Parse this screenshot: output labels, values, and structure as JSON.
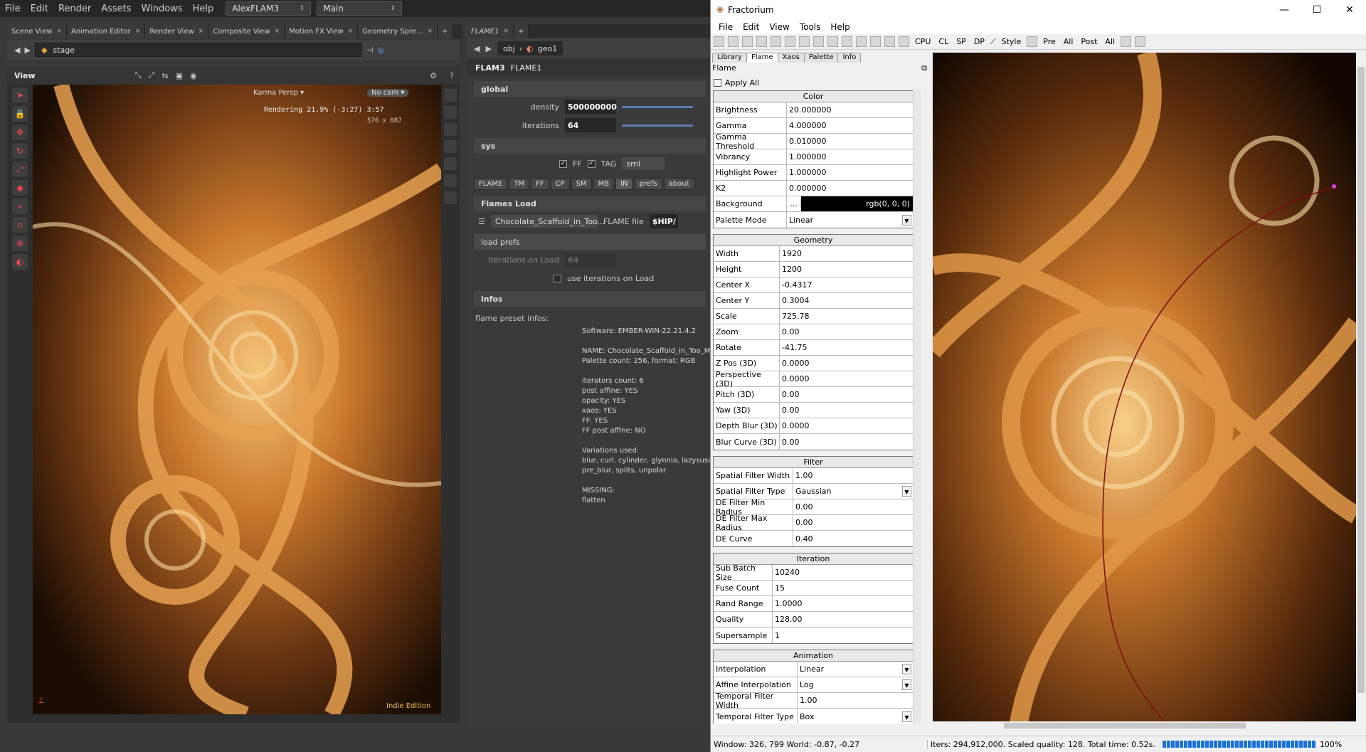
{
  "houdini": {
    "menu": [
      "File",
      "Edit",
      "Render",
      "Assets",
      "Windows",
      "Help"
    ],
    "desktop": "AlexFLAM3",
    "workspace": "Main",
    "viewer_tabs": [
      "Scene View",
      "Animation Editor",
      "Render View",
      "Composite View",
      "Motion FX View",
      "Geometry Spre..."
    ],
    "path": "stage",
    "view_label": "View",
    "renderer": "Karma Persp",
    "camera": "No cam",
    "render_status": "Rendering  21.9%  (-3:27)  3:57",
    "render_res": "576 x 887",
    "edition": "Indie Edition"
  },
  "params": {
    "tab": "FLAME1",
    "crumb_obj": "obj",
    "crumb_geo": "geo1",
    "node_type": "FLAM3",
    "node_name": "FLAME1",
    "global_label": "global",
    "density_label": "density",
    "density": "500000000",
    "iterations_label": "iterations",
    "iterations": "64",
    "sys_label": "sys",
    "ff_label": "FF",
    "tag_label": "TAG",
    "tag_value": "sml",
    "folder_tabs": [
      "FLAME",
      "TM",
      "FF",
      "CP",
      "SM",
      "MB",
      "IN",
      "prefs",
      "about"
    ],
    "flames_load": "Flames Load",
    "preset_name": "Chocolate_Scaffold_in_Too...",
    "flame_file_label": "FLAME file",
    "flame_file_value": "$HIP/",
    "load_prefs": "load prefs",
    "iter_on_load_label": "Iterations on Load",
    "iter_on_load": "64",
    "use_iter_label": "use iterations on Load",
    "infos_label": "infos",
    "preset_infos": "flame preset infos:",
    "info_text": "Software: EMBER-WIN-22.21.4.2\n\nNAME: Chocolate_Scaffold_in_Too_Ma\nPalette count: 256, format: RGB\n\niterators count: 6\npost affine: YES\nopacity: YES\nxaos: YES\nFF: YES\nFF post affine: NO\n\nVariations used:\nblur, curl, cylinder, glynnia, lazysusan\npre_blur, splits, unpolar\n\nMISSING:\nflatten"
  },
  "fractorium": {
    "title": "Fractorium",
    "menu": [
      "File",
      "Edit",
      "View",
      "Tools",
      "Help"
    ],
    "toolbar_text": [
      "CPU",
      "CL",
      "SP",
      "DP",
      "Style",
      "Pre",
      "All",
      "Post",
      "All"
    ],
    "tabs": [
      "Library",
      "Flame",
      "Xaos",
      "Palette",
      "Info"
    ],
    "panel_title": "Flame",
    "apply_all": "Apply All",
    "color": {
      "header": "Color",
      "rows": [
        {
          "label": "Brightness",
          "value": "20.000000"
        },
        {
          "label": "Gamma",
          "value": "4.000000"
        },
        {
          "label": "Gamma Threshold",
          "value": "0.010000"
        },
        {
          "label": "Vibrancy",
          "value": "1.000000"
        },
        {
          "label": "Highlight Power",
          "value": "1.000000"
        },
        {
          "label": "K2",
          "value": "0.000000"
        }
      ],
      "background_label": "Background",
      "background_btn": "...",
      "background_value": "rgb(0, 0, 0)",
      "palette_mode_label": "Palette Mode",
      "palette_mode": "Linear"
    },
    "geometry": {
      "header": "Geometry",
      "rows": [
        {
          "label": "Width",
          "value": "1920"
        },
        {
          "label": "Height",
          "value": "1200"
        },
        {
          "label": "Center X",
          "value": "-0.4317"
        },
        {
          "label": "Center Y",
          "value": "0.3004"
        },
        {
          "label": "Scale",
          "value": "725.78"
        },
        {
          "label": "Zoom",
          "value": "0.00"
        },
        {
          "label": "Rotate",
          "value": "-41.75"
        },
        {
          "label": "Z Pos (3D)",
          "value": "0.0000"
        },
        {
          "label": "Perspective (3D)",
          "value": "0.0000"
        },
        {
          "label": "Pitch (3D)",
          "value": "0.00"
        },
        {
          "label": "Yaw (3D)",
          "value": "0.00"
        },
        {
          "label": "Depth Blur (3D)",
          "value": "0.0000"
        },
        {
          "label": "Blur Curve (3D)",
          "value": "0.00"
        }
      ]
    },
    "filter": {
      "header": "Filter",
      "width_label": "Spatial Filter Width",
      "width": "1.00",
      "type_label": "Spatial Filter Type",
      "type": "Gaussian",
      "rows": [
        {
          "label": "DE Filter Min Radius",
          "value": "0.00"
        },
        {
          "label": "DE Filter Max Radius",
          "value": "0.00"
        },
        {
          "label": "DE Curve",
          "value": "0.40"
        }
      ]
    },
    "iteration": {
      "header": "Iteration",
      "rows": [
        {
          "label": "Sub Batch Size",
          "value": "10240"
        },
        {
          "label": "Fuse Count",
          "value": "15"
        },
        {
          "label": "Rand Range",
          "value": "1.0000"
        },
        {
          "label": "Quality",
          "value": "128.00"
        },
        {
          "label": "Supersample",
          "value": "1"
        }
      ]
    },
    "animation": {
      "header": "Animation",
      "interp_label": "Interpolation",
      "interp": "Linear",
      "affine_label": "Affine Interpolation",
      "affine": "Log",
      "tfw_label": "Temporal Filter Width",
      "tfw": "1.00",
      "tft_label": "Temporal Filter Type",
      "tft": "Box"
    },
    "status_left": "Window:  326,  799 World: -0.87, -0.27",
    "status_right": "Iters: 294,912,000. Scaled quality: 128. Total time: 0.52s.",
    "progress_pct": "100%",
    "progress_value": 1.0
  }
}
